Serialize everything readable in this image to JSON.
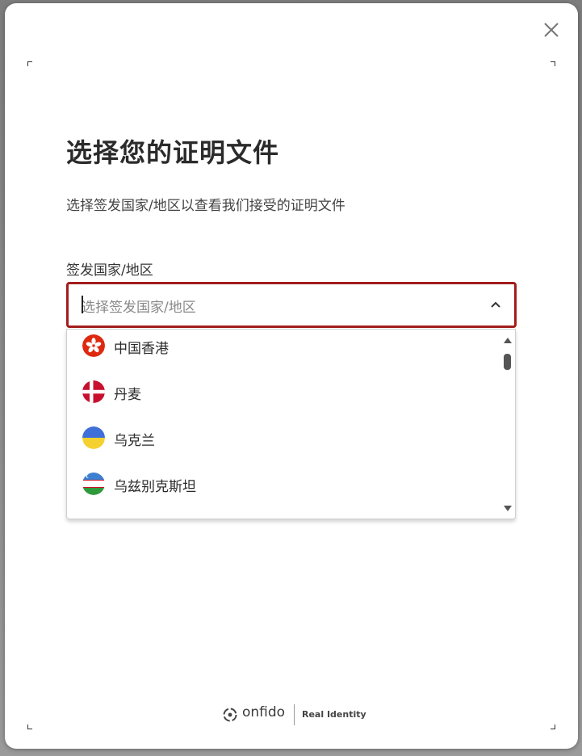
{
  "modal": {
    "title": "选择您的证明文件",
    "subtitle": "选择签发国家/地区以查看我们接受的证明文件",
    "field_label": "签发国家/地区",
    "select_placeholder": "选择签发国家/地区"
  },
  "dropdown": {
    "options": [
      {
        "label": "中国香港",
        "flag": "hong-kong-flag-icon"
      },
      {
        "label": "丹麦",
        "flag": "denmark-flag-icon"
      },
      {
        "label": "乌克兰",
        "flag": "ukraine-flag-icon"
      },
      {
        "label": "乌兹别克斯坦",
        "flag": "uzbekistan-flag-icon"
      }
    ]
  },
  "footer": {
    "brand_name": "onfido",
    "tagline": "Real Identity"
  },
  "colors": {
    "accent_border": "#a31d1d",
    "hong_kong_red": "#de2910",
    "denmark_red": "#c8102e",
    "ukraine_blue": "#3f6fd8",
    "ukraine_yellow": "#f5d130",
    "uzbekistan_blue": "#3d7fd1",
    "uzbekistan_green": "#2f9a3c",
    "uzbekistan_red": "#ce1126"
  },
  "icons": [
    "close-icon",
    "chevron-up-icon",
    "onfido-logo-icon"
  ]
}
